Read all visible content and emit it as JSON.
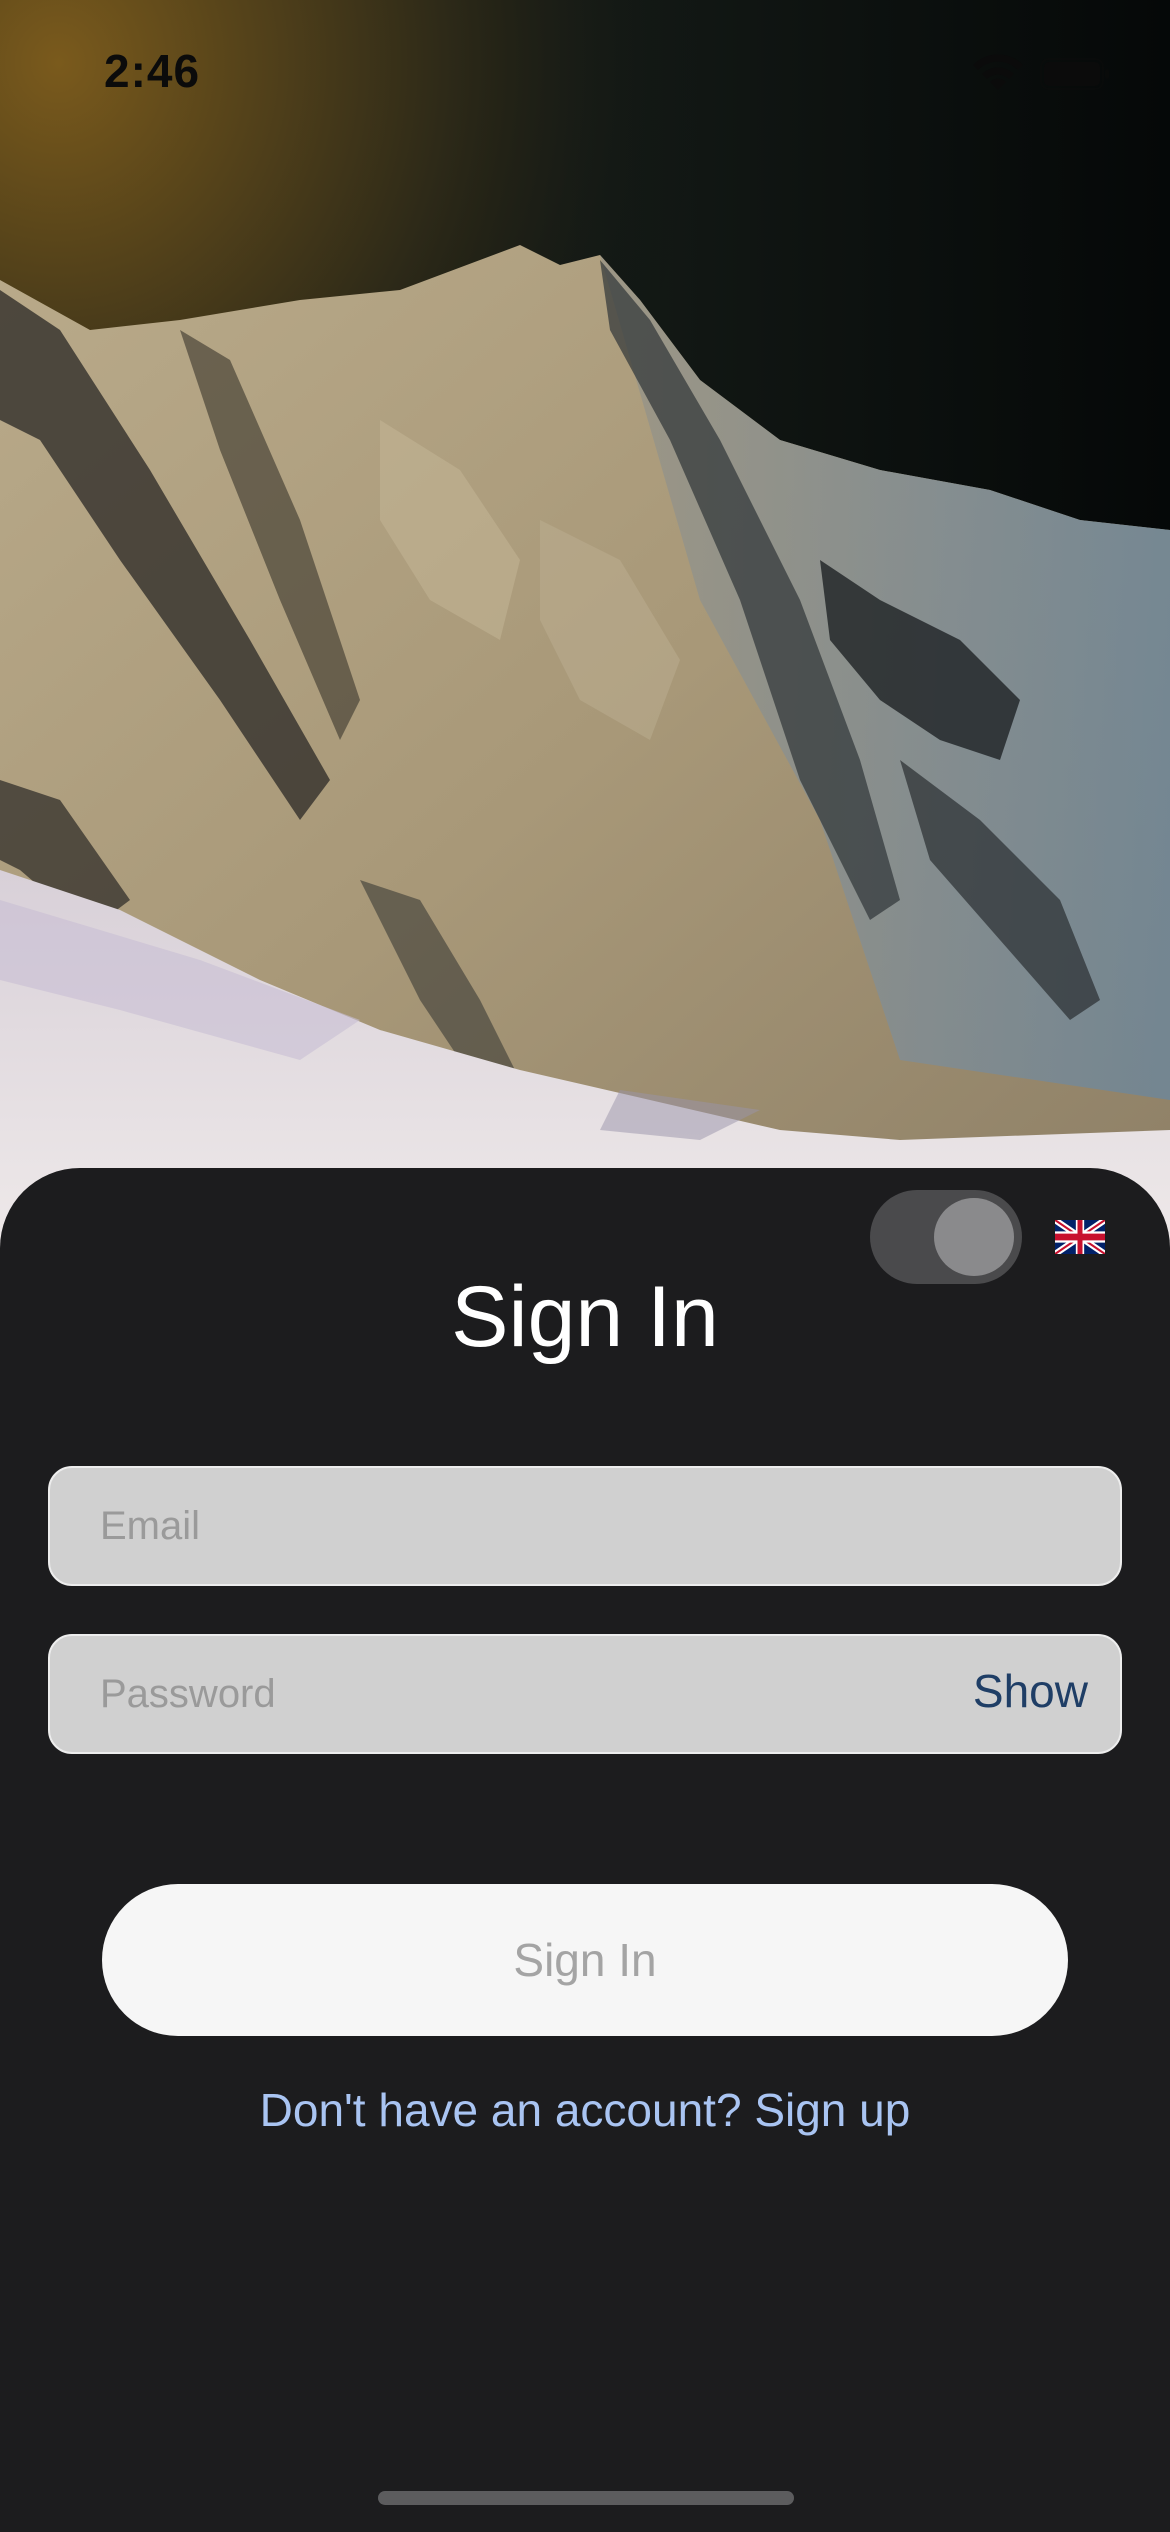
{
  "status_bar": {
    "time": "2:46",
    "wifi_icon": "wifi-icon",
    "battery_icon": "battery-icon"
  },
  "background": {
    "image": "mountain-photo"
  },
  "sheet": {
    "theme_toggle": {
      "state": "on"
    },
    "language_flag": "uk-flag-icon",
    "title": "Sign In",
    "email": {
      "placeholder": "Email",
      "value": ""
    },
    "password": {
      "placeholder": "Password",
      "value": "",
      "toggle_label": "Show"
    },
    "submit_label": "Sign In",
    "signup_link": "Don't have an account? Sign up"
  },
  "colors": {
    "sheet_background": "#1c1c1e",
    "link": "#a9c4f2",
    "show_button": "#1f3e66",
    "input_background": "#d0d0d0",
    "button_background": "#f6f6f6"
  }
}
